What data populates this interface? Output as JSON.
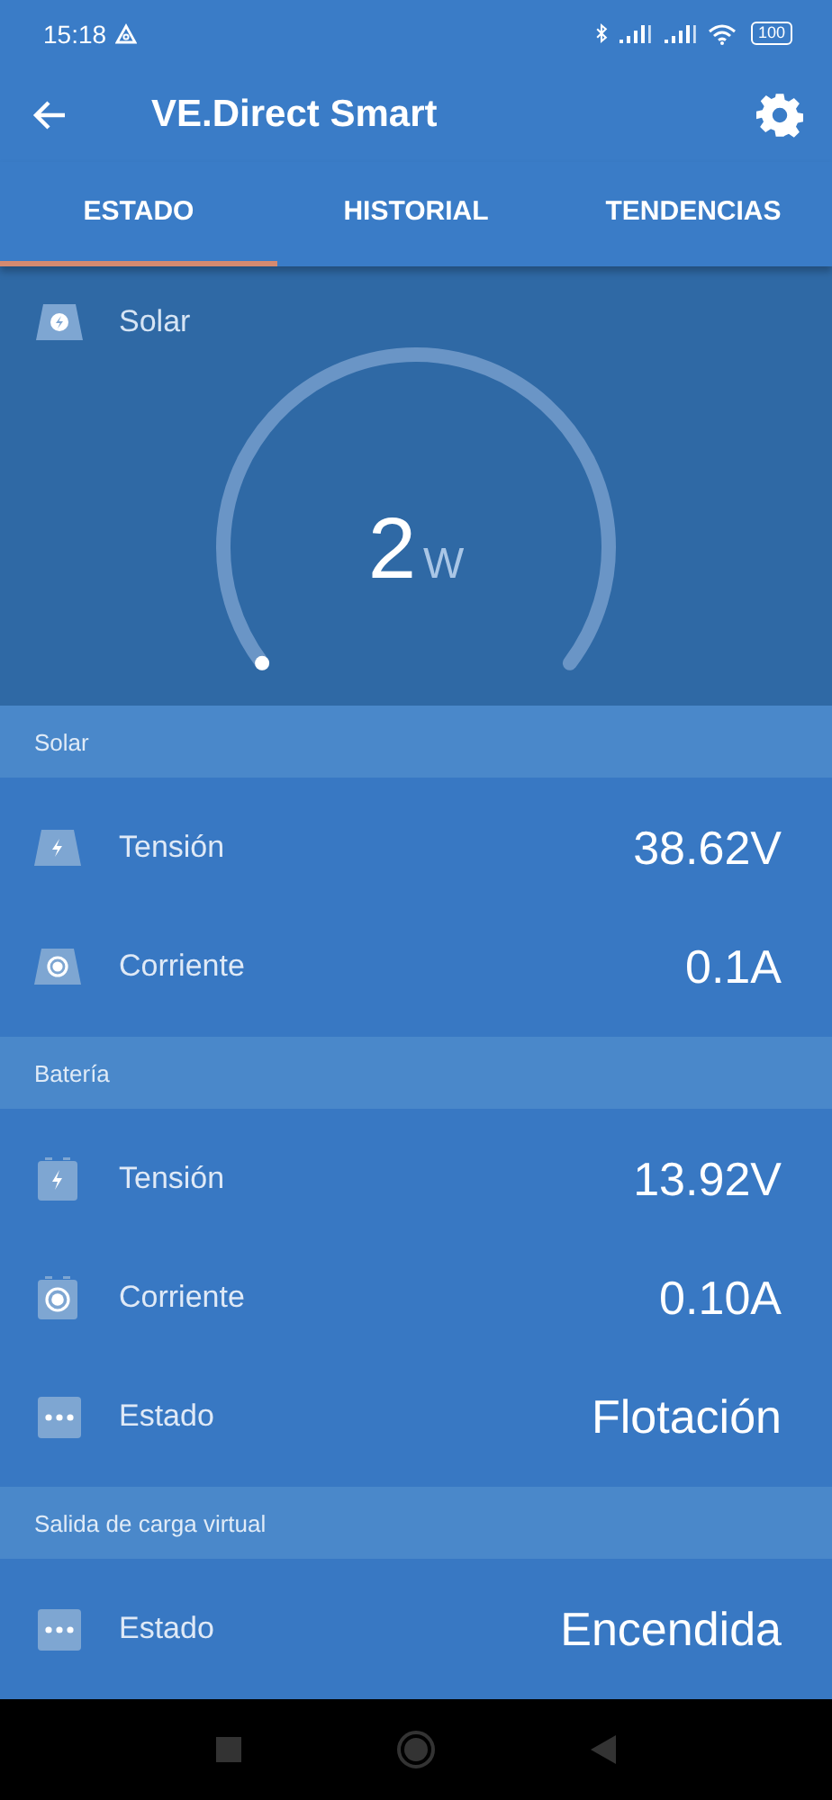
{
  "status_bar": {
    "time": "15:18",
    "battery": "100"
  },
  "app_bar": {
    "title": "VE.Direct Smart"
  },
  "tabs": [
    {
      "label": "ESTADO",
      "selected": true
    },
    {
      "label": "HISTORIAL",
      "selected": false
    },
    {
      "label": "TENDENCIAS",
      "selected": false
    }
  ],
  "gauge": {
    "label": "Solar",
    "value": "2",
    "unit": "W"
  },
  "sections": [
    {
      "title": "Solar",
      "rows": [
        {
          "kind": "panel-bolt",
          "label": "Tensión",
          "value": "38.62V"
        },
        {
          "kind": "panel-current",
          "label": "Corriente",
          "value": "0.1A"
        }
      ]
    },
    {
      "title": "Batería",
      "rows": [
        {
          "kind": "battery-bolt",
          "label": "Tensión",
          "value": "13.92V"
        },
        {
          "kind": "battery-current",
          "label": "Corriente",
          "value": "0.10A"
        },
        {
          "kind": "dots",
          "label": "Estado",
          "value": "Flotación"
        }
      ]
    },
    {
      "title": "Salida de carga virtual",
      "rows": [
        {
          "kind": "dots",
          "label": "Estado",
          "value": "Encendida"
        }
      ]
    }
  ]
}
